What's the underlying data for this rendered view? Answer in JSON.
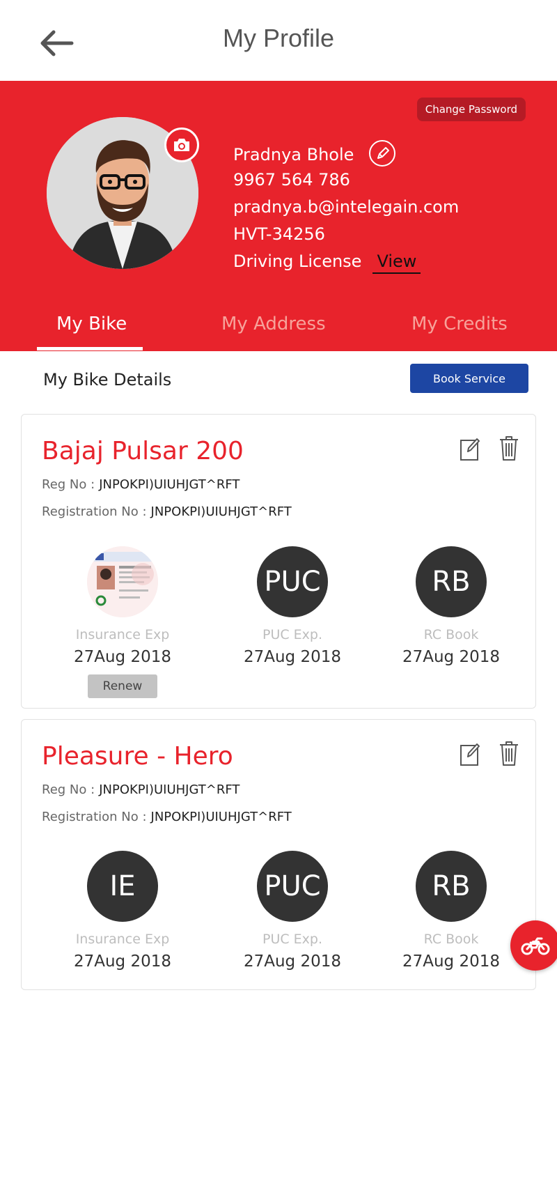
{
  "header": {
    "title": "My Profile"
  },
  "profile": {
    "change_password_label": "Change Password",
    "name": "Pradnya Bhole",
    "phone": "9967 564 786",
    "email": "pradnya.b@intelegain.com",
    "id": "HVT-34256",
    "license_label": "Driving License",
    "license_view": "View"
  },
  "tabs": [
    {
      "label": "My Bike",
      "active": true
    },
    {
      "label": "My Address",
      "active": false
    },
    {
      "label": "My Credits",
      "active": false
    }
  ],
  "section": {
    "title": "My Bike Details",
    "book_service": "Book Service"
  },
  "bikes": [
    {
      "name": "Bajaj Pulsar 200",
      "reg_no_label": "Reg No :",
      "reg_no": "JNPOKPI)UIUHJGT^RFT",
      "registration_label": "Registration No :",
      "registration_no": "JNPOKPI)UIUHJGT^RFT",
      "docs": [
        {
          "badge": "",
          "label": "Insurance Exp",
          "date": "27Aug 2018",
          "renew": "Renew"
        },
        {
          "badge": "PUC",
          "label": "PUC Exp.",
          "date": "27Aug 2018"
        },
        {
          "badge": "RB",
          "label": "RC Book",
          "date": "27Aug 2018"
        }
      ]
    },
    {
      "name": "Pleasure - Hero",
      "reg_no_label": "Reg No :",
      "reg_no": "JNPOKPI)UIUHJGT^RFT",
      "registration_label": "Registration No :",
      "registration_no": "JNPOKPI)UIUHJGT^RFT",
      "docs": [
        {
          "badge": "IE",
          "label": "Insurance Exp",
          "date": "27Aug 2018"
        },
        {
          "badge": "PUC",
          "label": "PUC Exp.",
          "date": "27Aug 2018"
        },
        {
          "badge": "RB",
          "label": "RC Book",
          "date": "27Aug 2018"
        }
      ]
    }
  ],
  "colors": {
    "brand_red": "#e8232c",
    "dark_red": "#b51b25",
    "book_blue": "#1d46a3",
    "badge_dark": "#333333"
  },
  "icons": {
    "back": "arrow-left-icon",
    "camera": "camera-icon",
    "edit": "pencil-icon",
    "card_edit": "edit-icon",
    "card_delete": "trash-icon",
    "fab": "motorbike-icon"
  }
}
